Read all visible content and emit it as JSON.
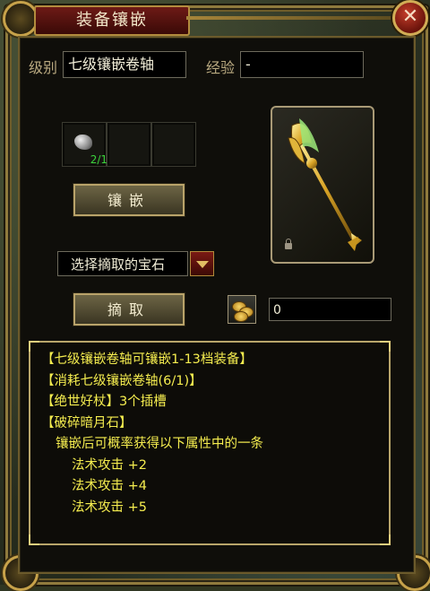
{
  "window": {
    "title": "装备镶嵌",
    "close_label": "✕"
  },
  "fields": {
    "level_label": "级别",
    "level_value": "七级镶嵌卷轴",
    "exp_label": "经验",
    "exp_value": "-"
  },
  "slots": [
    {
      "item": "stone",
      "count": "2/1"
    },
    {
      "item": "",
      "count": ""
    },
    {
      "item": "",
      "count": ""
    }
  ],
  "buttons": {
    "inlay": "镶嵌",
    "extract": "摘取"
  },
  "gem_select": {
    "selected": "选择摘取的宝石"
  },
  "gold": {
    "value": "0",
    "icon": "gold-coins-icon"
  },
  "item_preview": {
    "icon": "staff-icon",
    "lock_icon": "lock-icon"
  },
  "info_lines": [
    "【七级镶嵌卷轴可镶嵌1-13档装备】",
    "【消耗七级镶嵌卷轴(6/1)】",
    "【绝世好杖】3个插槽",
    "【破碎暗月石】",
    "镶嵌后可概率获得以下属性中的一条",
    "法术攻击 +2",
    "法术攻击 +4",
    "法术攻击 +5"
  ],
  "colors": {
    "info_text": "#f5ed4f",
    "slot_count": "#3bd13b",
    "title_bg": "#6d1a16",
    "frame_gold": "#b8a56a"
  }
}
